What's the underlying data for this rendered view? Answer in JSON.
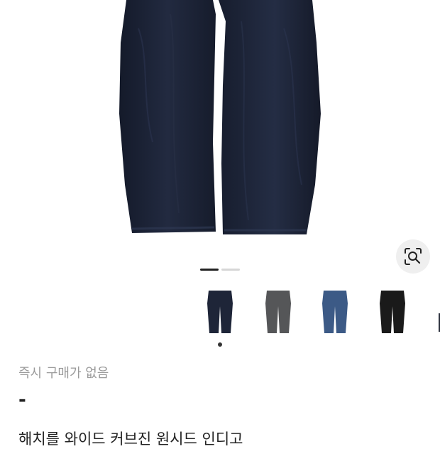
{
  "product": {
    "status_text": "즉시 구매가 없음",
    "price": "-",
    "title": "해치를 와이드 커브진 원시드 인디고"
  },
  "gallery": {
    "slide_count": 2,
    "active_slide": 1
  },
  "thumbnails": [
    {
      "name": "indigo",
      "color": "#1e2538"
    },
    {
      "name": "grey",
      "color": "#555658"
    },
    {
      "name": "blue",
      "color": "#3c5a86"
    },
    {
      "name": "black",
      "color": "#1a1a1a"
    }
  ],
  "colors": {
    "denim": "#1b2134",
    "accent": "#222222"
  },
  "icons": {
    "lens": "lens-search-icon"
  }
}
